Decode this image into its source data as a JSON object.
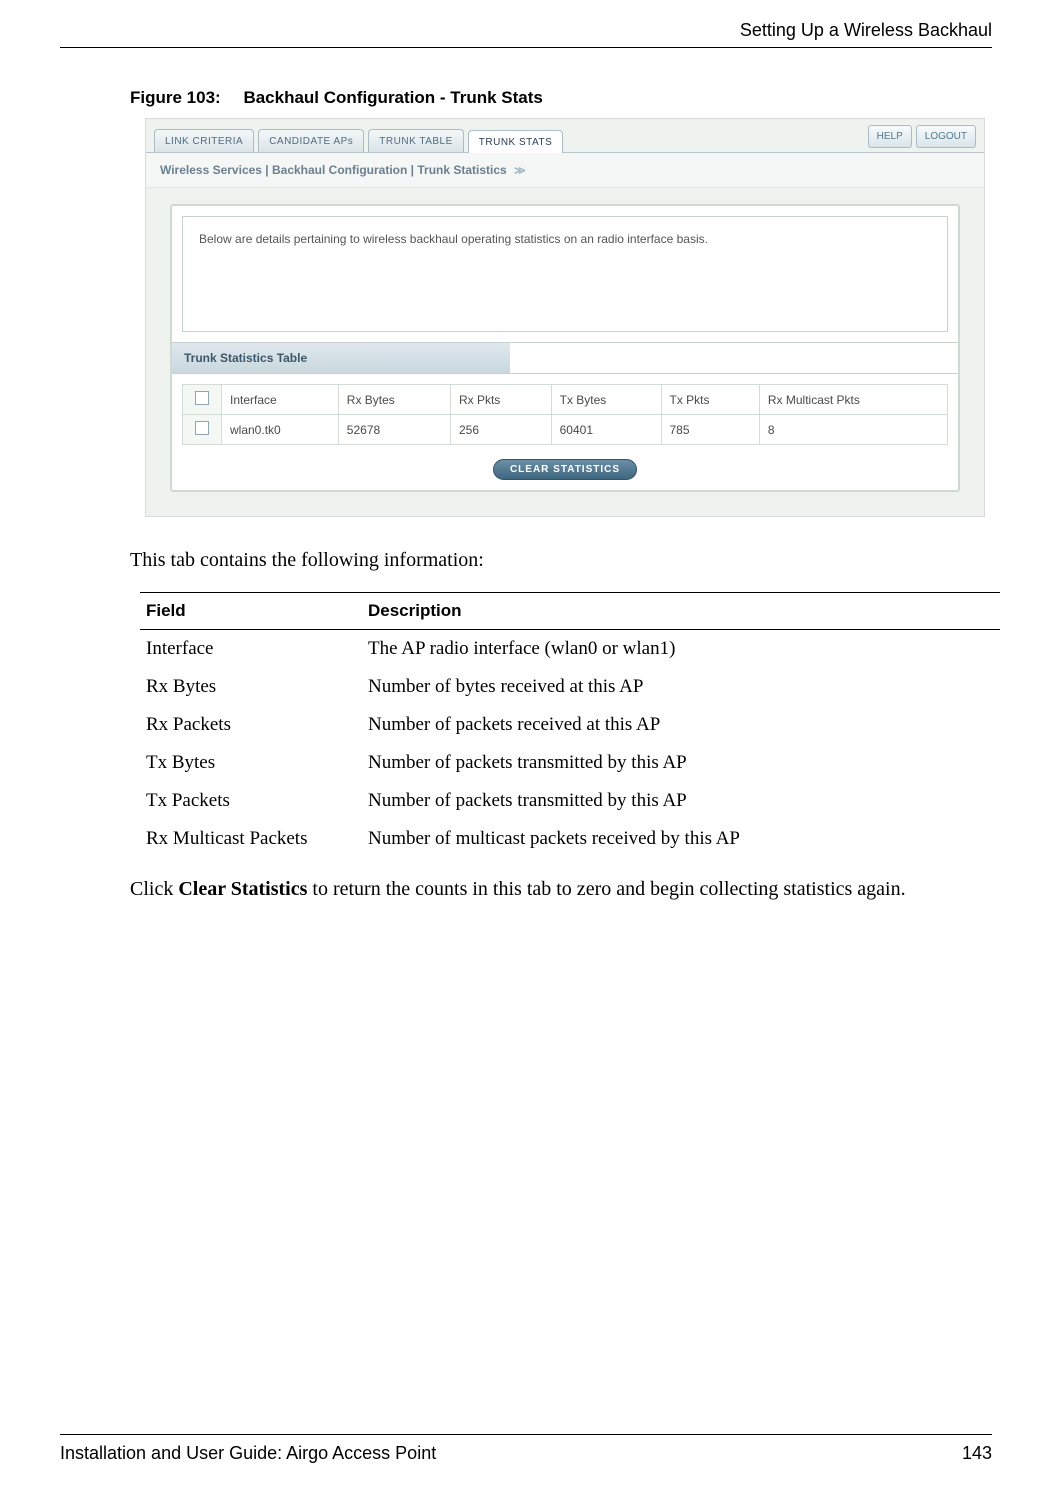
{
  "header": {
    "running_title": "Setting Up a Wireless Backhaul"
  },
  "figure": {
    "label": "Figure 103:",
    "title": "Backhaul Configuration - Trunk Stats"
  },
  "screenshot": {
    "tabs": {
      "items": [
        "LINK CRITERIA",
        "CANDIDATE APs",
        "TRUNK TABLE",
        "TRUNK STATS"
      ],
      "active_index": 3
    },
    "buttons": {
      "help": "HELP",
      "logout": "LOGOUT"
    },
    "breadcrumb": "Wireless Services | Backhaul Configuration | Trunk Statistics",
    "description": "Below are details pertaining to wireless backhaul operating statistics on an radio interface basis.",
    "section_title": "Trunk Statistics Table",
    "table": {
      "headers": [
        "Interface",
        "Rx Bytes",
        "Rx Pkts",
        "Tx Bytes",
        "Tx Pkts",
        "Rx Multicast Pkts"
      ],
      "rows": [
        {
          "cells": [
            "wlan0.tk0",
            "52678",
            "256",
            "60401",
            "785",
            "8"
          ]
        }
      ]
    },
    "clear_button": "CLEAR STATISTICS"
  },
  "body": {
    "intro": "This tab contains the following information:",
    "field_table": {
      "head_field": "Field",
      "head_desc": "Description",
      "rows": [
        {
          "field": "Interface",
          "desc": "The AP radio interface (wlan0 or wlan1)"
        },
        {
          "field": "Rx Bytes",
          "desc": "Number of bytes received at this AP"
        },
        {
          "field": "Rx Packets",
          "desc": "Number of packets received at this AP"
        },
        {
          "field": "Tx Bytes",
          "desc": "Number of packets transmitted by this AP"
        },
        {
          "field": "Tx Packets",
          "desc": "Number of packets transmitted by this AP"
        },
        {
          "field": "Rx Multicast Packets",
          "desc": "Number of multicast packets received by this AP"
        }
      ]
    },
    "outro_pre": "Click ",
    "outro_bold": "Clear Statistics",
    "outro_post": " to return the counts in this tab to zero and begin collecting statistics again."
  },
  "footer": {
    "left": "Installation and User Guide: Airgo Access Point",
    "right": "143"
  }
}
